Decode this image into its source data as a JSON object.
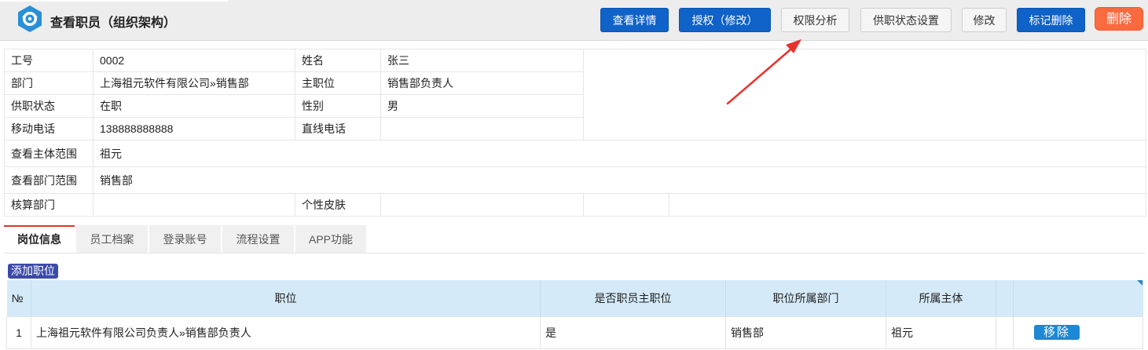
{
  "header": {
    "title": "查看职员（组织架构）",
    "logo_icon": "eye-logo-icon",
    "buttons": {
      "view_details": "查看详情",
      "authorize": "授权（修改）",
      "permission_analysis": "权限分析",
      "employment_status": "供职状态设置",
      "edit": "修改",
      "mark_delete": "标记删除",
      "delete": "删除"
    }
  },
  "info": {
    "employee_no_label": "工号",
    "employee_no": "0002",
    "name_label": "姓名",
    "name": "张三",
    "dept_label": "部门",
    "dept": "上海祖元软件有限公司»销售部",
    "main_position_label": "主职位",
    "main_position": "销售部负责人",
    "status_label": "供职状态",
    "status": "在职",
    "gender_label": "性别",
    "gender": "男",
    "mobile_label": "移动电话",
    "mobile": "138888888888",
    "direct_phone_label": "直线电话",
    "direct_phone": "",
    "entity_scope_label": "查看主体范围",
    "entity_scope": "祖元",
    "dept_scope_label": "查看部门范围",
    "dept_scope": "销售部",
    "accounting_dept_label": "核算部门",
    "accounting_dept": "",
    "skin_label": "个性皮肤",
    "skin": ""
  },
  "tabs": [
    "岗位信息",
    "员工档案",
    "登录账号",
    "流程设置",
    "APP功能"
  ],
  "add_position_label": "添加职位",
  "grid": {
    "headers": [
      "№",
      "职位",
      "是否职员主职位",
      "职位所属部门",
      "所属主体"
    ],
    "rows": [
      {
        "no": "1",
        "position": "上海祖元软件有限公司负责人»销售部负责人",
        "is_main": "是",
        "dept": "销售部",
        "entity": "祖元",
        "action": "移除"
      }
    ]
  },
  "colors": {
    "primary_button": "#0f62c8",
    "delete_button": "#f96a3f",
    "grid_header": "#d5eaf8",
    "active_tab_border": "#d23b1f",
    "arrow": "#e8322c"
  }
}
